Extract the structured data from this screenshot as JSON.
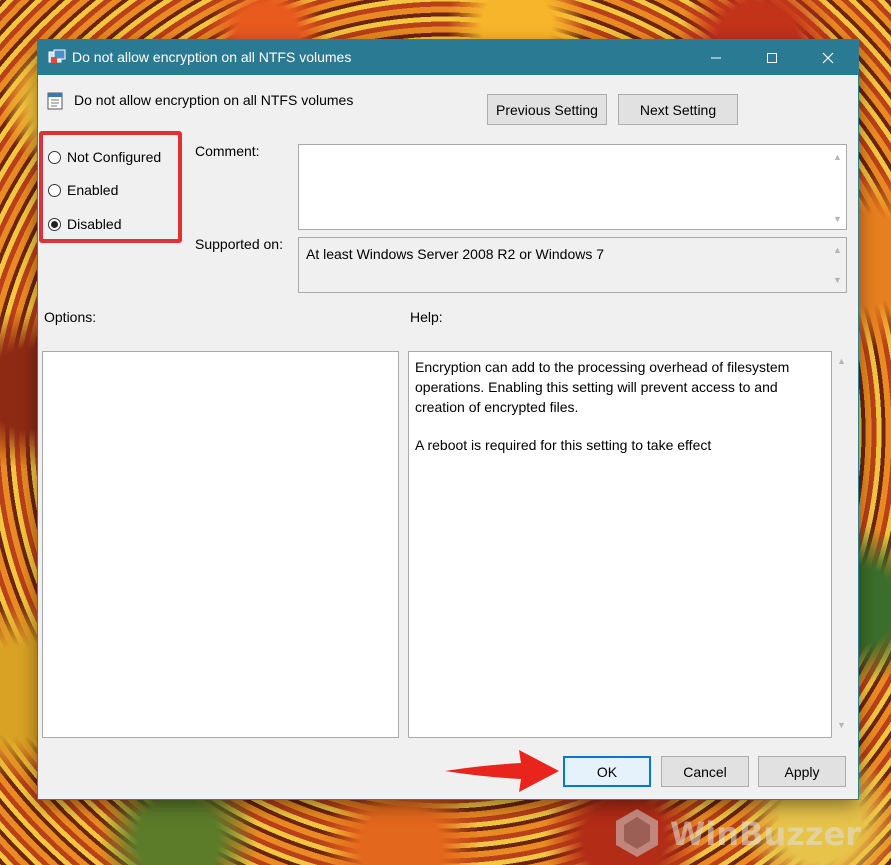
{
  "window": {
    "title": "Do not allow encryption on all NTFS volumes",
    "policy_name": "Do not allow encryption on all NTFS volumes"
  },
  "nav": {
    "previous_label": "Previous Setting",
    "next_label": "Next Setting"
  },
  "state": {
    "options": [
      {
        "label": "Not Configured",
        "selected": false
      },
      {
        "label": "Enabled",
        "selected": false
      },
      {
        "label": "Disabled",
        "selected": true
      }
    ]
  },
  "comment": {
    "label": "Comment:",
    "value": ""
  },
  "supported": {
    "label": "Supported on:",
    "value": "At least Windows Server 2008 R2 or Windows 7"
  },
  "options_panel": {
    "label": "Options:"
  },
  "help_panel": {
    "label": "Help:",
    "paragraphs": [
      "Encryption can add to the processing overhead of filesystem operations.  Enabling this setting will prevent access to and creation of encrypted files.",
      "A reboot is required for this setting to take effect"
    ]
  },
  "footer": {
    "ok_label": "OK",
    "cancel_label": "Cancel",
    "apply_label": "Apply"
  },
  "watermark": {
    "text": "WinBuzzer"
  },
  "colors": {
    "titlebar": "#2b7a93",
    "highlight": "#e03232",
    "arrow": "#e8241c",
    "ok_border": "#0078d7"
  }
}
